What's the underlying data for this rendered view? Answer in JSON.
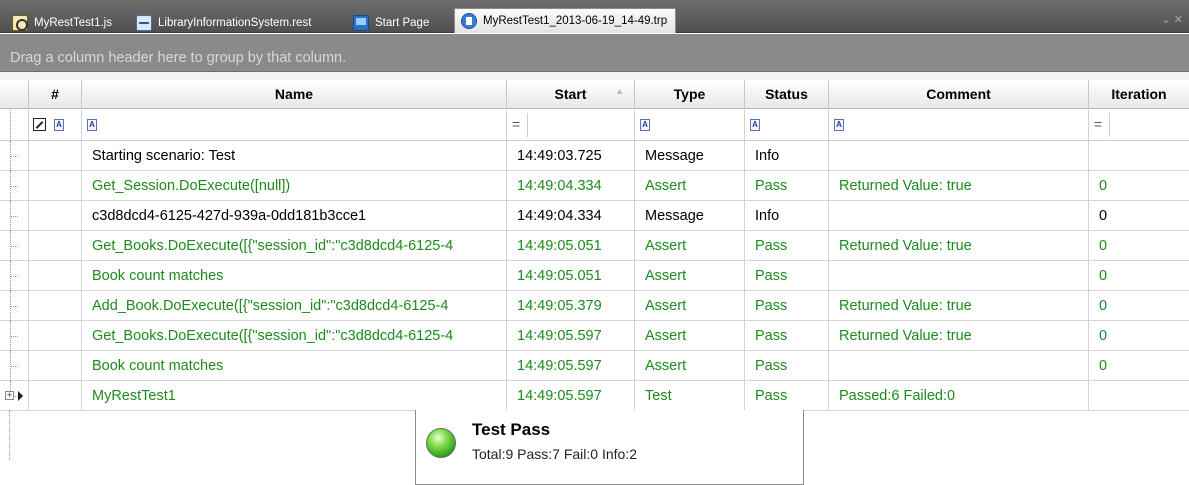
{
  "tabs": [
    {
      "label": "MyRestTest1.js",
      "icon": "js-file-icon"
    },
    {
      "label": "LibraryInformationSystem.rest",
      "icon": "rest-file-icon"
    },
    {
      "label": "Start Page",
      "icon": "start-page-icon"
    },
    {
      "label": "MyRestTest1_2013-06-19_14-49.trp",
      "icon": "report-file-icon",
      "active": true
    }
  ],
  "group_panel_text": "Drag a column header here to group by that column.",
  "columns": {
    "num": "#",
    "name": "Name",
    "start": "Start",
    "type": "Type",
    "status": "Status",
    "comment": "Comment",
    "iteration": "Iteration"
  },
  "filter_row": {
    "text_filter_glyph": "A",
    "equals_glyph": "="
  },
  "rows": [
    {
      "name": "Starting scenario: Test",
      "start": "14:49:03.725",
      "type": "Message",
      "status": "Info",
      "comment": "",
      "iteration": "",
      "color": "#000000"
    },
    {
      "name": "Get_Session.DoExecute([null])",
      "start": "14:49:04.334",
      "type": "Assert",
      "status": "Pass",
      "comment": "Returned Value: true",
      "iteration": "0",
      "color": "#1d8a1d"
    },
    {
      "name": "c3d8dcd4-6125-427d-939a-0dd181b3cce1",
      "start": "14:49:04.334",
      "type": "Message",
      "status": "Info",
      "comment": "",
      "iteration": "0",
      "color": "#000000"
    },
    {
      "name": "Get_Books.DoExecute([{\"session_id\":\"c3d8dcd4-6125-4",
      "start": "14:49:05.051",
      "type": "Assert",
      "status": "Pass",
      "comment": "Returned Value: true",
      "iteration": "0",
      "color": "#1d8a1d"
    },
    {
      "name": "Book count matches",
      "start": "14:49:05.051",
      "type": "Assert",
      "status": "Pass",
      "comment": "",
      "iteration": "0",
      "color": "#1d8a1d"
    },
    {
      "name": "Add_Book.DoExecute([{\"session_id\":\"c3d8dcd4-6125-4",
      "start": "14:49:05.379",
      "type": "Assert",
      "status": "Pass",
      "comment": "Returned Value: true",
      "iteration": "0",
      "color": "#1d8a1d"
    },
    {
      "name": "Get_Books.DoExecute([{\"session_id\":\"c3d8dcd4-6125-4",
      "start": "14:49:05.597",
      "type": "Assert",
      "status": "Pass",
      "comment": "Returned Value: true",
      "iteration": "0",
      "color": "#1d8a1d"
    },
    {
      "name": "Book count matches",
      "start": "14:49:05.597",
      "type": "Assert",
      "status": "Pass",
      "comment": "",
      "iteration": "0",
      "color": "#1d8a1d"
    },
    {
      "name": "MyRestTest1",
      "start": "14:49:05.597",
      "type": "Test",
      "status": "Pass",
      "comment": "Passed:6 Failed:0",
      "iteration": "",
      "color": "#1d8a1d",
      "expandable": true,
      "current": true
    }
  ],
  "summary": {
    "title": "Test Pass",
    "detail": "Total:9 Pass:7 Fail:0 Info:2",
    "status_color": "#3fbf2a"
  }
}
